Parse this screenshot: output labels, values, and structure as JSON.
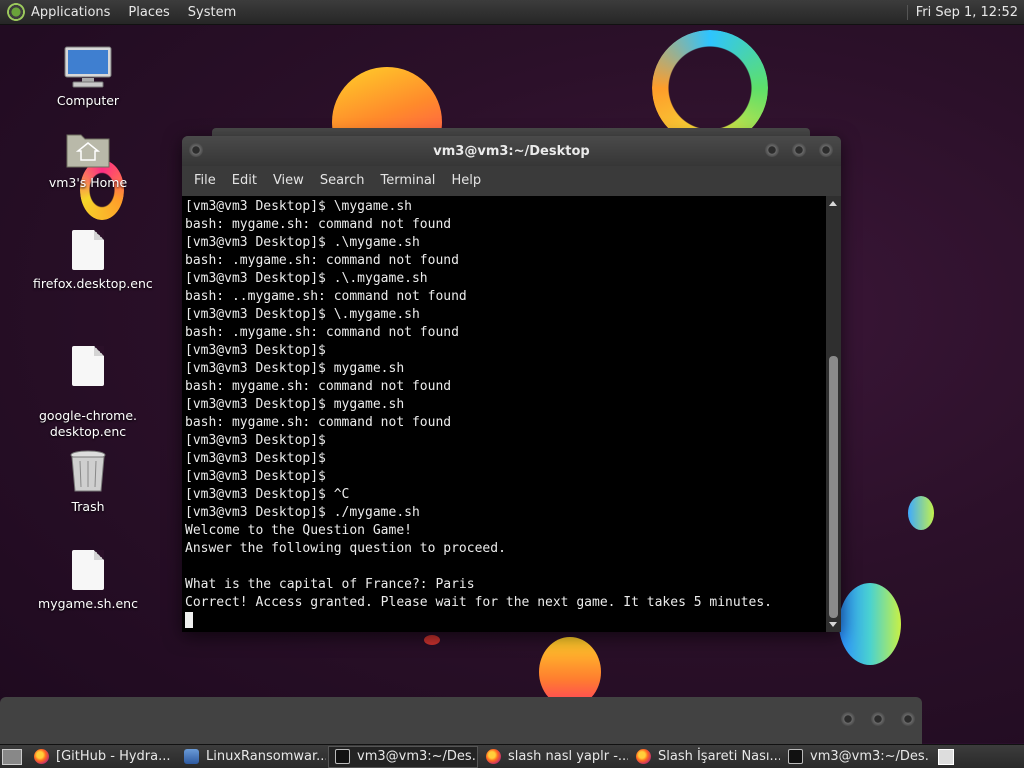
{
  "top_panel": {
    "menus": [
      "Applications",
      "Places",
      "System"
    ],
    "clock": "Fri Sep  1, 12:52"
  },
  "desktop_icons": [
    {
      "label": "Computer",
      "icon": "computer-icon"
    },
    {
      "label": "vm3's Home",
      "icon": "home-folder-icon"
    },
    {
      "label": "firefox.desktop.enc",
      "icon": "file-icon"
    },
    {
      "label": "google-chrome.\ndesktop.enc",
      "icon": "file-icon"
    },
    {
      "label": "Trash",
      "icon": "trash-icon"
    },
    {
      "label": "mygame.sh.enc",
      "icon": "file-icon"
    }
  ],
  "terminal": {
    "title": "vm3@vm3:~/Desktop",
    "menu": [
      "File",
      "Edit",
      "View",
      "Search",
      "Terminal",
      "Help"
    ],
    "lines": [
      "[vm3@vm3 Desktop]$ \\mygame.sh",
      "bash: mygame.sh: command not found",
      "[vm3@vm3 Desktop]$ .\\mygame.sh",
      "bash: .mygame.sh: command not found",
      "[vm3@vm3 Desktop]$ .\\.mygame.sh",
      "bash: ..mygame.sh: command not found",
      "[vm3@vm3 Desktop]$ \\.mygame.sh",
      "bash: .mygame.sh: command not found",
      "[vm3@vm3 Desktop]$",
      "[vm3@vm3 Desktop]$ mygame.sh",
      "bash: mygame.sh: command not found",
      "[vm3@vm3 Desktop]$ mygame.sh",
      "bash: mygame.sh: command not found",
      "[vm3@vm3 Desktop]$",
      "[vm3@vm3 Desktop]$",
      "[vm3@vm3 Desktop]$",
      "[vm3@vm3 Desktop]$ ^C",
      "[vm3@vm3 Desktop]$ ./mygame.sh",
      "Welcome to the Question Game!",
      "Answer the following question to proceed.",
      "",
      "What is the capital of France?: Paris",
      "Correct! Access granted. Please wait for the next game. It takes 5 minutes."
    ]
  },
  "taskbar": [
    {
      "label": "[GitHub - Hydra...",
      "icon": "firefox-icon",
      "active": false
    },
    {
      "label": "LinuxRansomwar...",
      "icon": "app-icon",
      "active": false
    },
    {
      "label": "vm3@vm3:~/Des...",
      "icon": "terminal-icon",
      "active": true
    },
    {
      "label": "slash nasl yaplr -...",
      "icon": "firefox-icon",
      "active": false
    },
    {
      "label": "Slash İşareti Nası...",
      "icon": "firefox-icon",
      "active": false
    },
    {
      "label": "vm3@vm3:~/Des...",
      "icon": "terminal-icon",
      "active": false
    }
  ]
}
